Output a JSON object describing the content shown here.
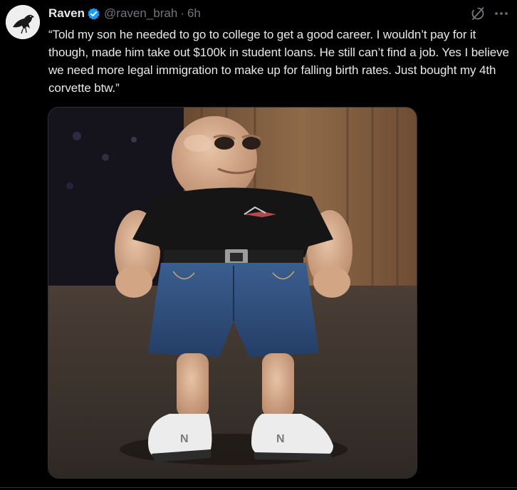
{
  "post": {
    "display_name": "Raven",
    "handle": "@raven_brah",
    "separator": "·",
    "time": "6h",
    "text": "“Told my son he needed to go to college to get a good career.  I wouldn’t pay for it though, made him take out $100k in student loans.  He still can’t find a job. Yes I believe we need more legal immigration to make up for falling birth rates. Just bought my 4th corvette btw.”"
  },
  "icons": {
    "verified": "verified-badge-icon",
    "grok": "grok-icon",
    "more": "more-options-icon",
    "avatar": "raven-avatar"
  },
  "colors": {
    "background": "#000000",
    "text": "#e7e9ea",
    "muted": "#71767b",
    "verified_blue": "#1d9bf0"
  }
}
